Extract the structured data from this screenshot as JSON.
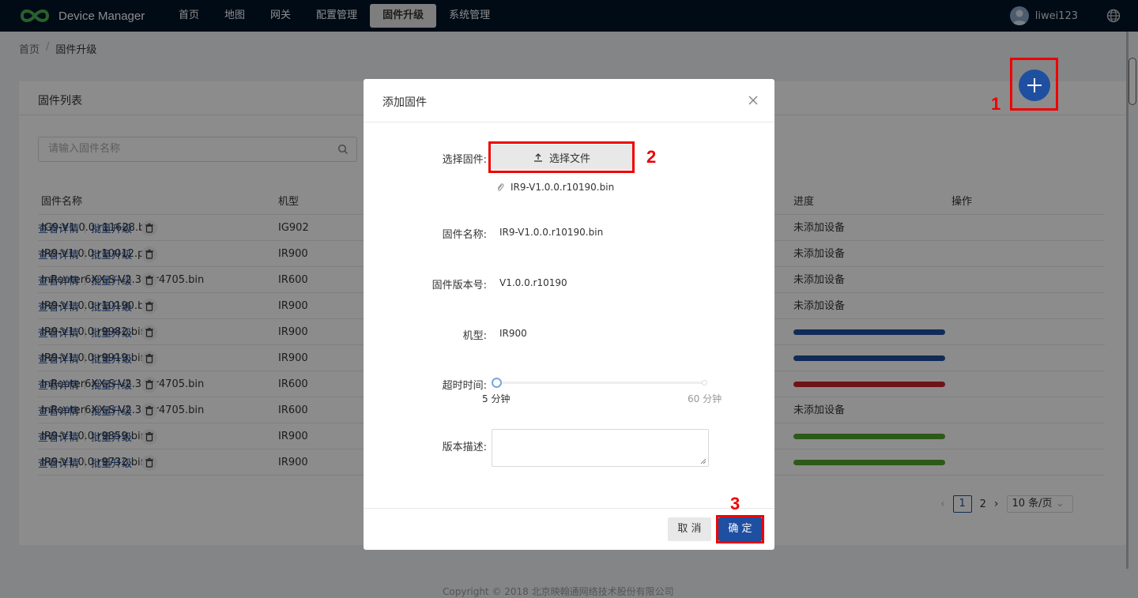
{
  "app": {
    "title": "Device Manager"
  },
  "nav": [
    {
      "label": "首页",
      "active": false
    },
    {
      "label": "地图",
      "active": false
    },
    {
      "label": "网关",
      "active": false
    },
    {
      "label": "配置管理",
      "active": false
    },
    {
      "label": "固件升级",
      "active": true
    },
    {
      "label": "系统管理",
      "active": false
    }
  ],
  "user": {
    "name": "liwei123"
  },
  "breadcrumb": {
    "home": "首页",
    "sep": "/",
    "current": "固件升级"
  },
  "card": {
    "title": "固件列表",
    "search_placeholder": "请输入固件名称"
  },
  "table": {
    "headers": {
      "name": "固件名称",
      "model": "机型",
      "progress": "进度",
      "ops": "操作"
    },
    "ops": {
      "detail": "查看详情",
      "batch": "批量升级"
    },
    "rows": [
      {
        "name": "IG9-V1.0.0.r11628.bin",
        "model": "IG902",
        "status": "未添加设备",
        "bar": null
      },
      {
        "name": "IR9-V1.0.0.r10012.pkg",
        "model": "IR900",
        "status": "未添加设备",
        "bar": null
      },
      {
        "name": "InRouter6XX-S-V2.3.0.r4705.bin",
        "model": "IR600",
        "status": "未添加设备",
        "bar": null
      },
      {
        "name": "IR9-V1.0.0.r10190.bin",
        "model": "IR900",
        "status": "未添加设备",
        "bar": null
      },
      {
        "name": "IR9-V1.0.0.r9982.bin",
        "model": "IR900",
        "status": "",
        "bar": "#1f4fa0"
      },
      {
        "name": "IR9-V1.0.0.r9919.bin",
        "model": "IR900",
        "status": "",
        "bar": "#1f4fa0"
      },
      {
        "name": "InRouter6XX-S-V2.3.0.r4705.bin",
        "model": "IR600",
        "status": "",
        "bar": "#c8232c"
      },
      {
        "name": "InRouter6XX-S-V2.3.0.r4705.bin",
        "model": "IR600",
        "status": "未添加设备",
        "bar": null
      },
      {
        "name": "IR9-V1.0.0.r9859.bin",
        "model": "IR900",
        "status": "",
        "bar": "#52a32e"
      },
      {
        "name": "IR9-V1.0.0.r9732.bin",
        "model": "IR900",
        "status": "",
        "bar": "#52a32e"
      }
    ]
  },
  "pager": {
    "page1": "1",
    "page2": "2",
    "size": "10 条/页"
  },
  "footer": {
    "text": "Copyright © 2018 北京映翰通网络技术股份有限公司"
  },
  "modal": {
    "title": "添加固件",
    "select_label": "选择固件:",
    "select_button": "选择文件",
    "file_name": "IR9-V1.0.0.r10190.bin",
    "name_label": "固件名称:",
    "name_value": "IR9-V1.0.0.r10190.bin",
    "version_label": "固件版本号:",
    "version_value": "V1.0.0.r10190",
    "model_label": "机型:",
    "model_value": "IR900",
    "timeout_label": "超时时间:",
    "timeout_min": "5 分钟",
    "timeout_max": "60 分钟",
    "desc_label": "版本描述:",
    "cancel": "取 消",
    "ok": "确 定"
  },
  "annotations": {
    "n1": "1",
    "n2": "2",
    "n3": "3"
  }
}
